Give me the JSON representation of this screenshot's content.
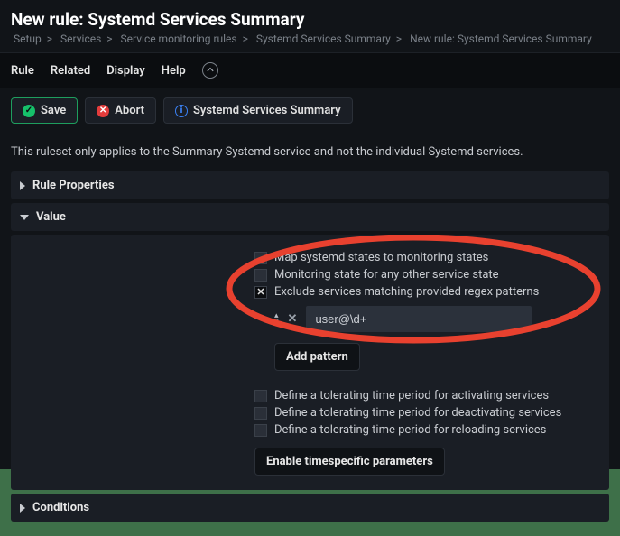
{
  "header": {
    "title": "New rule: Systemd Services Summary",
    "breadcrumb": [
      "Setup",
      "Services",
      "Service monitoring rules",
      "Systemd Services Summary",
      "New rule: Systemd Services Summary"
    ]
  },
  "tabs": {
    "rule": "Rule",
    "related": "Related",
    "display": "Display",
    "help": "Help"
  },
  "toolbar": {
    "save": "Save",
    "abort": "Abort",
    "context": "Systemd Services Summary"
  },
  "description": "This ruleset only applies to the Summary Systemd service and not the individual Systemd services.",
  "sections": {
    "rule_properties": "Rule Properties",
    "value": "Value",
    "conditions": "Conditions"
  },
  "value": {
    "options": {
      "map_states": "Map systemd states to monitoring states",
      "other_state": "Monitoring state for any other service state",
      "exclude_regex": "Exclude services matching provided regex patterns",
      "tol_activating": "Define a tolerating time period for activating services",
      "tol_deactivating": "Define a tolerating time period for deactivating services",
      "tol_reloading": "Define a tolerating time period for reloading services"
    },
    "pattern_value": "user@\\d+",
    "add_pattern": "Add pattern",
    "enable_timespecific": "Enable timespecific parameters"
  }
}
